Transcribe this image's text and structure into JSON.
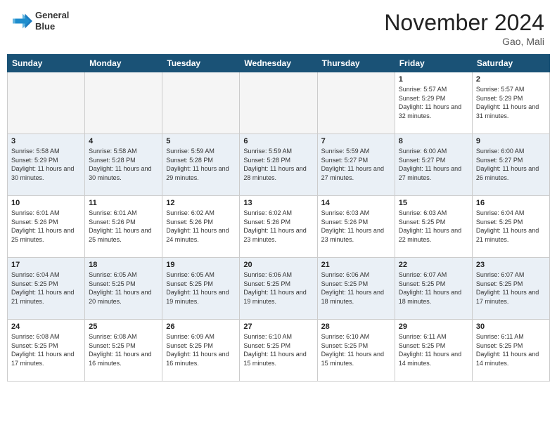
{
  "header": {
    "logo_line1": "General",
    "logo_line2": "Blue",
    "month": "November 2024",
    "location": "Gao, Mali"
  },
  "weekdays": [
    "Sunday",
    "Monday",
    "Tuesday",
    "Wednesday",
    "Thursday",
    "Friday",
    "Saturday"
  ],
  "weeks": [
    [
      {
        "day": "",
        "info": ""
      },
      {
        "day": "",
        "info": ""
      },
      {
        "day": "",
        "info": ""
      },
      {
        "day": "",
        "info": ""
      },
      {
        "day": "",
        "info": ""
      },
      {
        "day": "1",
        "info": "Sunrise: 5:57 AM\nSunset: 5:29 PM\nDaylight: 11 hours and 32 minutes."
      },
      {
        "day": "2",
        "info": "Sunrise: 5:57 AM\nSunset: 5:29 PM\nDaylight: 11 hours and 31 minutes."
      }
    ],
    [
      {
        "day": "3",
        "info": "Sunrise: 5:58 AM\nSunset: 5:29 PM\nDaylight: 11 hours and 30 minutes."
      },
      {
        "day": "4",
        "info": "Sunrise: 5:58 AM\nSunset: 5:28 PM\nDaylight: 11 hours and 30 minutes."
      },
      {
        "day": "5",
        "info": "Sunrise: 5:59 AM\nSunset: 5:28 PM\nDaylight: 11 hours and 29 minutes."
      },
      {
        "day": "6",
        "info": "Sunrise: 5:59 AM\nSunset: 5:28 PM\nDaylight: 11 hours and 28 minutes."
      },
      {
        "day": "7",
        "info": "Sunrise: 5:59 AM\nSunset: 5:27 PM\nDaylight: 11 hours and 27 minutes."
      },
      {
        "day": "8",
        "info": "Sunrise: 6:00 AM\nSunset: 5:27 PM\nDaylight: 11 hours and 27 minutes."
      },
      {
        "day": "9",
        "info": "Sunrise: 6:00 AM\nSunset: 5:27 PM\nDaylight: 11 hours and 26 minutes."
      }
    ],
    [
      {
        "day": "10",
        "info": "Sunrise: 6:01 AM\nSunset: 5:26 PM\nDaylight: 11 hours and 25 minutes."
      },
      {
        "day": "11",
        "info": "Sunrise: 6:01 AM\nSunset: 5:26 PM\nDaylight: 11 hours and 25 minutes."
      },
      {
        "day": "12",
        "info": "Sunrise: 6:02 AM\nSunset: 5:26 PM\nDaylight: 11 hours and 24 minutes."
      },
      {
        "day": "13",
        "info": "Sunrise: 6:02 AM\nSunset: 5:26 PM\nDaylight: 11 hours and 23 minutes."
      },
      {
        "day": "14",
        "info": "Sunrise: 6:03 AM\nSunset: 5:26 PM\nDaylight: 11 hours and 23 minutes."
      },
      {
        "day": "15",
        "info": "Sunrise: 6:03 AM\nSunset: 5:25 PM\nDaylight: 11 hours and 22 minutes."
      },
      {
        "day": "16",
        "info": "Sunrise: 6:04 AM\nSunset: 5:25 PM\nDaylight: 11 hours and 21 minutes."
      }
    ],
    [
      {
        "day": "17",
        "info": "Sunrise: 6:04 AM\nSunset: 5:25 PM\nDaylight: 11 hours and 21 minutes."
      },
      {
        "day": "18",
        "info": "Sunrise: 6:05 AM\nSunset: 5:25 PM\nDaylight: 11 hours and 20 minutes."
      },
      {
        "day": "19",
        "info": "Sunrise: 6:05 AM\nSunset: 5:25 PM\nDaylight: 11 hours and 19 minutes."
      },
      {
        "day": "20",
        "info": "Sunrise: 6:06 AM\nSunset: 5:25 PM\nDaylight: 11 hours and 19 minutes."
      },
      {
        "day": "21",
        "info": "Sunrise: 6:06 AM\nSunset: 5:25 PM\nDaylight: 11 hours and 18 minutes."
      },
      {
        "day": "22",
        "info": "Sunrise: 6:07 AM\nSunset: 5:25 PM\nDaylight: 11 hours and 18 minutes."
      },
      {
        "day": "23",
        "info": "Sunrise: 6:07 AM\nSunset: 5:25 PM\nDaylight: 11 hours and 17 minutes."
      }
    ],
    [
      {
        "day": "24",
        "info": "Sunrise: 6:08 AM\nSunset: 5:25 PM\nDaylight: 11 hours and 17 minutes."
      },
      {
        "day": "25",
        "info": "Sunrise: 6:08 AM\nSunset: 5:25 PM\nDaylight: 11 hours and 16 minutes."
      },
      {
        "day": "26",
        "info": "Sunrise: 6:09 AM\nSunset: 5:25 PM\nDaylight: 11 hours and 16 minutes."
      },
      {
        "day": "27",
        "info": "Sunrise: 6:10 AM\nSunset: 5:25 PM\nDaylight: 11 hours and 15 minutes."
      },
      {
        "day": "28",
        "info": "Sunrise: 6:10 AM\nSunset: 5:25 PM\nDaylight: 11 hours and 15 minutes."
      },
      {
        "day": "29",
        "info": "Sunrise: 6:11 AM\nSunset: 5:25 PM\nDaylight: 11 hours and 14 minutes."
      },
      {
        "day": "30",
        "info": "Sunrise: 6:11 AM\nSunset: 5:25 PM\nDaylight: 11 hours and 14 minutes."
      }
    ]
  ]
}
